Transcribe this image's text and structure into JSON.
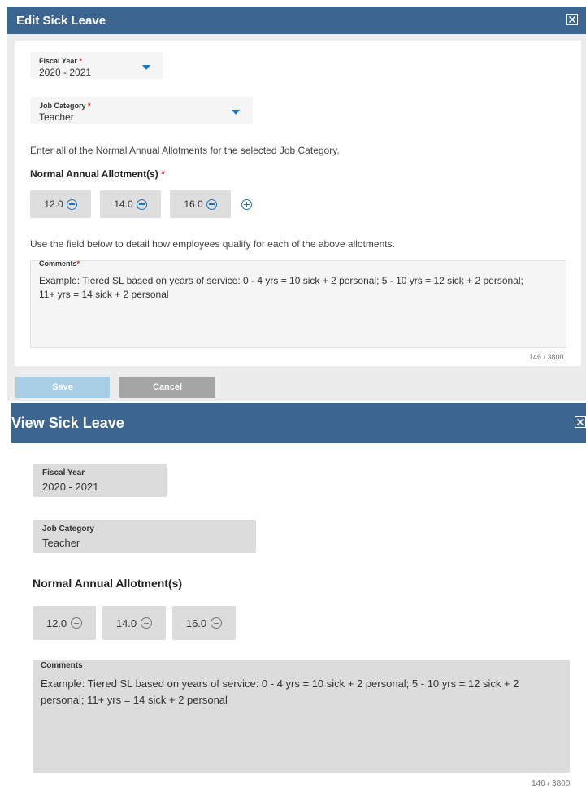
{
  "edit": {
    "title": "Edit Sick Leave",
    "fiscal_year": {
      "label": "Fiscal Year",
      "required_mark": "*",
      "value": "2020 - 2021"
    },
    "job_category": {
      "label": "Job Category",
      "required_mark": "*",
      "value": "Teacher"
    },
    "instruction_allotments": "Enter all of the Normal Annual Allotments for the selected Job Category.",
    "allotments_title": "Normal Annual Allotment(s)",
    "allotments_required_mark": "*",
    "allotments": [
      "12.0",
      "14.0",
      "16.0"
    ],
    "instruction_comments": "Use the field below to detail how employees qualify for each of the above allotments.",
    "comments": {
      "label": "Comments",
      "required_mark": "*",
      "value": "Example: Tiered SL based on years of service:  0 - 4 yrs = 10 sick + 2 personal; 5 - 10 yrs = 12 sick + 2 personal; 11+ yrs = 14 sick + 2 personal",
      "counter": "146 / 3800"
    },
    "save_label": "Save",
    "cancel_label": "Cancel"
  },
  "view": {
    "title": "View Sick Leave",
    "fiscal_year": {
      "label": "Fiscal Year",
      "value": "2020 - 2021"
    },
    "job_category": {
      "label": "Job Category",
      "value": "Teacher"
    },
    "allotments_title": "Normal Annual Allotment(s)",
    "allotments": [
      "12.0",
      "14.0",
      "16.0"
    ],
    "comments": {
      "label": "Comments",
      "value": "Example: Tiered SL based on years of service:  0 - 4 yrs = 10 sick + 2 personal; 5 - 10 yrs = 12 sick + 2 personal; 11+ yrs = 14 sick + 2 personal",
      "counter": "146 / 3800"
    }
  },
  "colors": {
    "header_blue": "#3c6590",
    "accent_blue": "#1b76c4",
    "required_red": "#d9262a",
    "save_disabled": "#a9cfe6",
    "cancel_gray": "#a5a5a5"
  }
}
